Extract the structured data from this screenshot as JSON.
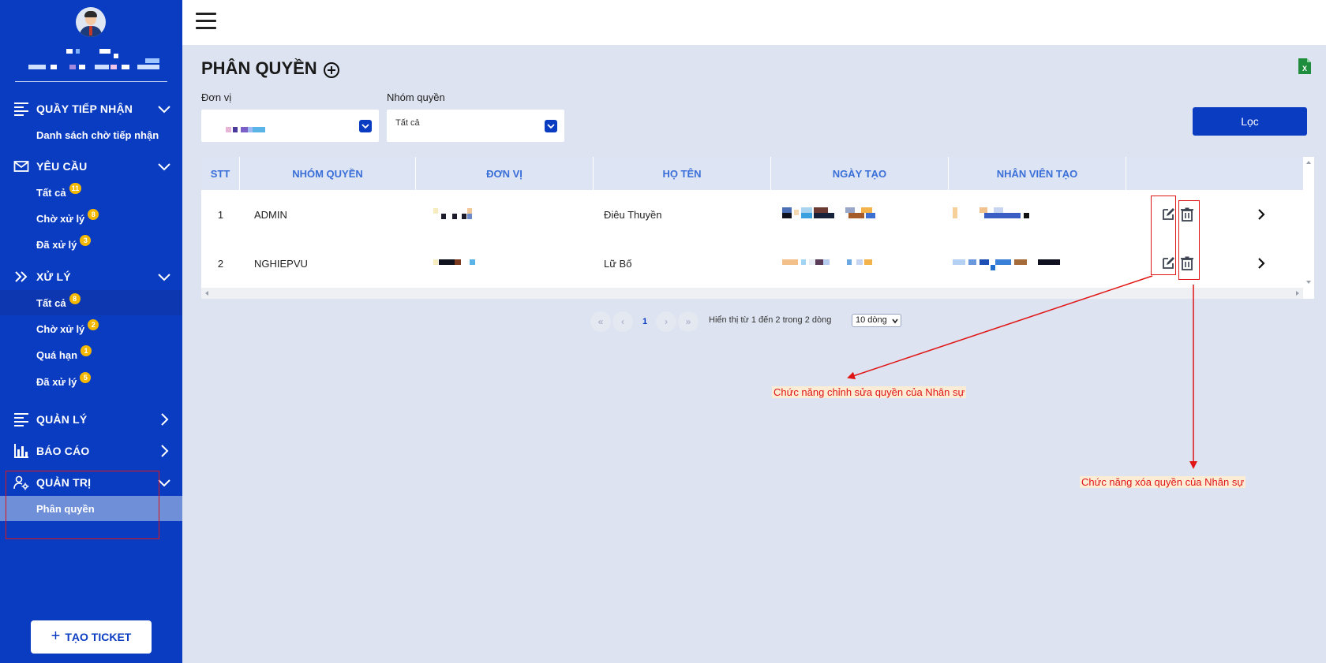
{
  "sidebar": {
    "sections": [
      {
        "label": "QUẦY TIẾP NHẬN",
        "icon": "list-icon",
        "expanded": true,
        "items": [
          {
            "label": "Danh sách chờ tiếp nhận"
          }
        ]
      },
      {
        "label": "YÊU CẦU",
        "icon": "mail-icon",
        "expanded": true,
        "items": [
          {
            "label": "Tất cả",
            "badge": "11"
          },
          {
            "label": "Chờ xử lý",
            "badge": "8"
          },
          {
            "label": "Đã xử lý",
            "badge": "3"
          }
        ]
      },
      {
        "label": "XỬ LÝ",
        "icon": "double-chevron-right-icon",
        "expanded": true,
        "items": [
          {
            "label": "Tất cả",
            "badge": "8"
          },
          {
            "label": "Chờ xử lý",
            "badge": "2"
          },
          {
            "label": "Quá hạn",
            "badge": "1"
          },
          {
            "label": "Đã xử lý",
            "badge": "5"
          }
        ]
      },
      {
        "label": "QUẢN LÝ",
        "icon": "list-icon",
        "expanded": false,
        "items": []
      },
      {
        "label": "BÁO CÁO",
        "icon": "bar-chart-icon",
        "expanded": false,
        "items": []
      },
      {
        "label": "QUẢN TRỊ",
        "icon": "user-gear-icon",
        "expanded": true,
        "items": [
          {
            "label": "Phân quyền",
            "active": true
          }
        ]
      }
    ],
    "create_ticket_label": "TẠO TICKET"
  },
  "page": {
    "title": "PHÂN QUYỀN"
  },
  "filters": {
    "unit_label": "Đơn vị",
    "group_label": "Nhóm quyền",
    "group_value": "Tất cả",
    "filter_button": "Lọc"
  },
  "table": {
    "columns": [
      "STT",
      "NHÓM QUYỀN",
      "ĐƠN VỊ",
      "HỌ TÊN",
      "NGÀY TẠO",
      "NHÂN VIÊN TẠO"
    ],
    "rows": [
      {
        "stt": "1",
        "group": "ADMIN",
        "name": "Điêu Thuyền"
      },
      {
        "stt": "2",
        "group": "NGHIEPVU",
        "name": "Lữ Bố"
      }
    ]
  },
  "pagination": {
    "first": "«",
    "prev": "‹",
    "current": "1",
    "next": "›",
    "last": "»",
    "info": "Hiển thị từ 1 đến 2 trong 2 dòng",
    "page_size": "10 dòng"
  },
  "annotations": {
    "edit_note": "Chức năng chỉnh sửa quyền của Nhân sự",
    "delete_note": "Chức năng xóa quyền của Nhân sự"
  },
  "colors": {
    "sidebar": "#0a3cc2",
    "accent": "#0a3cc2",
    "background": "#dde3f0",
    "annotation": "#e01515",
    "badge": "#f5b800"
  }
}
